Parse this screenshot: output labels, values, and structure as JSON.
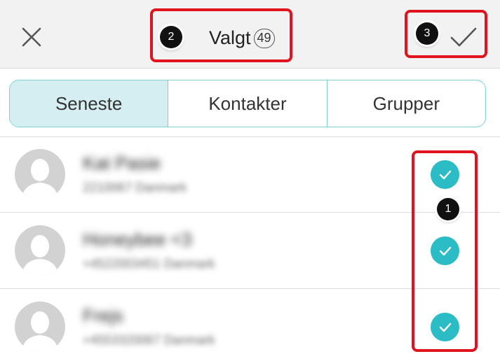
{
  "header": {
    "title": "Valgt",
    "selected_count": "49",
    "close_icon": "close-icon",
    "confirm_icon": "checkmark-icon"
  },
  "tabs": [
    {
      "label": "Seneste",
      "active": true
    },
    {
      "label": "Kontakter",
      "active": false
    },
    {
      "label": "Grupper",
      "active": false
    }
  ],
  "contacts": [
    {
      "name": "Kat Pasie",
      "detail": "2210067 Danmark",
      "selected": true
    },
    {
      "name": "Honeybee <3",
      "detail": "+4522003451 Danmark",
      "selected": true
    },
    {
      "name": "Frejs",
      "detail": "+4553320067 Danmark",
      "selected": true
    }
  ],
  "annotations": {
    "marker_1": "1",
    "marker_2": "2",
    "marker_3": "3"
  },
  "colors": {
    "accent": "#2bbcc6",
    "tab_active_bg": "#d4eef1",
    "tab_border": "#7fcfd6",
    "callout": "#e0141f",
    "header_bg": "#f2f2f2"
  }
}
